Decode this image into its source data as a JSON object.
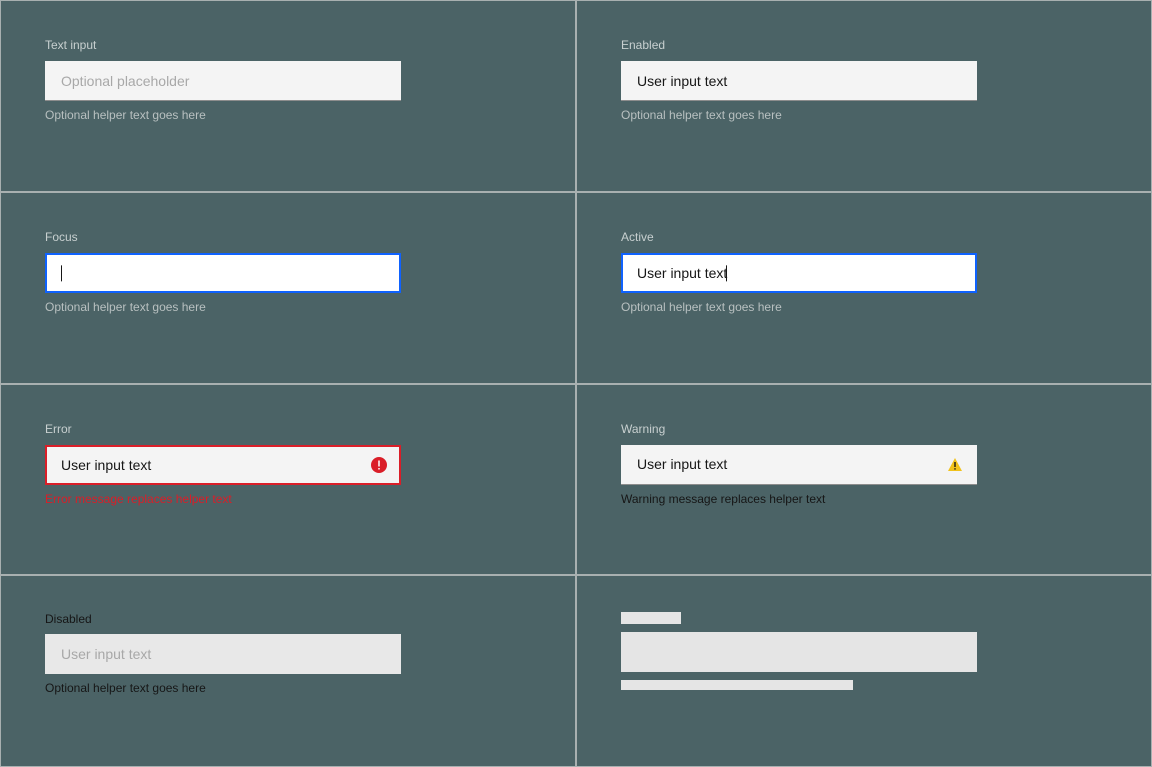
{
  "states": {
    "default": {
      "label": "Text input",
      "placeholder": "Optional placeholder",
      "helper": "Optional helper text goes here"
    },
    "enabled": {
      "label": "Enabled",
      "value": "User input text",
      "helper": "Optional helper text goes here"
    },
    "focus": {
      "label": "Focus",
      "helper": "Optional helper text goes here"
    },
    "active": {
      "label": "Active",
      "value": "User input text",
      "helper": "Optional helper text goes here"
    },
    "error": {
      "label": "Error",
      "value": "User input text",
      "helper": "Error message replaces helper text"
    },
    "warning": {
      "label": "Warning",
      "value": "User input text",
      "helper": "Warning message replaces helper text"
    },
    "disabled": {
      "label": "Disabled",
      "value": "User input text",
      "helper": "Optional helper text goes here"
    }
  },
  "colors": {
    "focus": "#0f62fe",
    "error": "#da1e28",
    "warning": "#f1c21b",
    "background": "#4b6366"
  }
}
